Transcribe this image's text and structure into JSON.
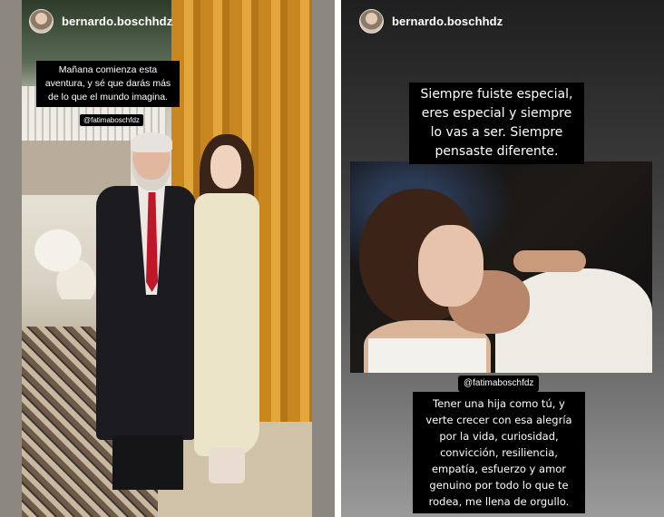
{
  "left_story": {
    "username": "bernardo.boschhdz",
    "avatar_icon": "profile-avatar",
    "caption": "Mañana comienza esta aventura, y sé que darás más de lo que el mundo imagina.",
    "mention": "@fatimaboschfdz"
  },
  "right_story": {
    "username": "bernardo.boschhdz",
    "avatar_icon": "profile-avatar",
    "caption_top": "Siempre fuiste especial, eres especial y siempre lo vas a ser. Siempre pensaste diferente.",
    "mention": "@fatimaboschfdz",
    "caption_bottom": "Tener una hija como tú, y verte crecer con esa alegría por la vida, curiosidad, convicción, resiliencia, empatía, esfuerzo y amor genuino por todo lo que te rodea, me llena de orgullo."
  }
}
